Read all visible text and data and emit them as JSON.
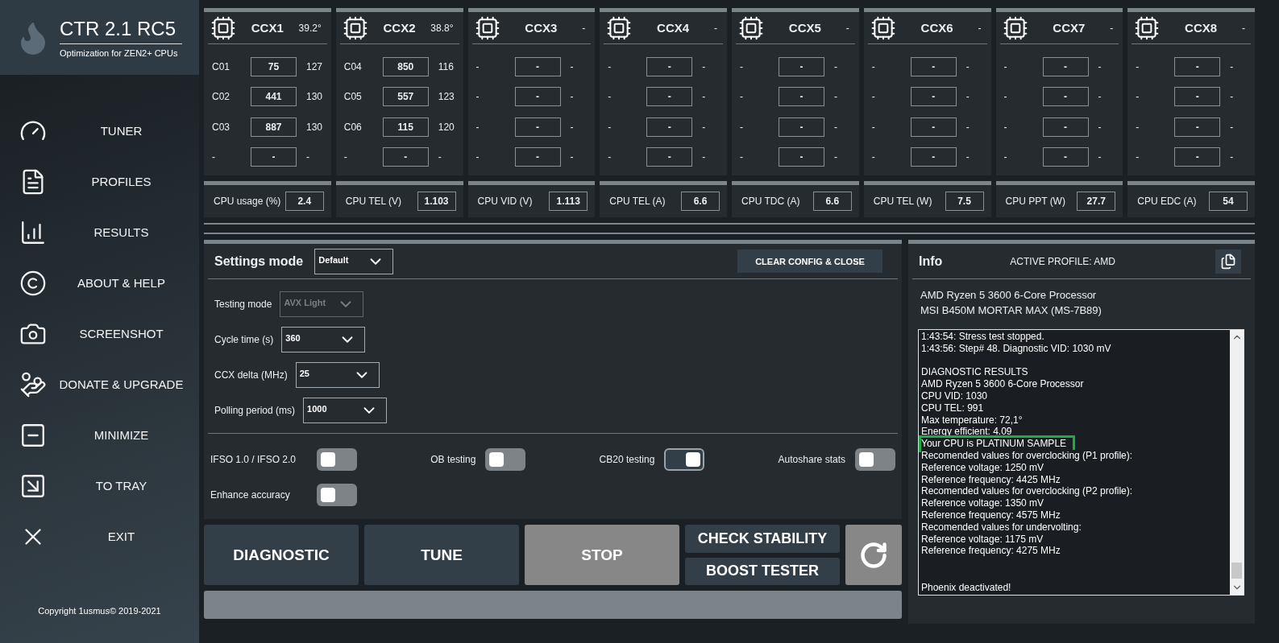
{
  "app": {
    "title": "CTR 2.1 RC5",
    "subtitle": "Optimization for ZEN2+ CPUs"
  },
  "nav": [
    {
      "label": "TUNER",
      "kind": "gauge"
    },
    {
      "label": "PROFILES",
      "kind": "list"
    },
    {
      "label": "RESULTS",
      "kind": "chart"
    },
    {
      "label": "ABOUT & HELP",
      "kind": "copyright"
    },
    {
      "label": "SCREENSHOT",
      "kind": "camera"
    },
    {
      "label": "DONATE & UPGRADE",
      "kind": "donate"
    },
    {
      "label": "MINIMIZE",
      "kind": "minimize"
    },
    {
      "label": "TO TRAY",
      "kind": "tray"
    },
    {
      "label": "EXIT",
      "kind": "exit"
    }
  ],
  "copyright": "Copyright 1usmus© 2019-2021",
  "ccx": [
    {
      "name": "CCX1",
      "temp": "39.2°",
      "cores": [
        {
          "label": "C01",
          "value": "75",
          "reading": "127"
        },
        {
          "label": "C02",
          "value": "441",
          "reading": "130"
        },
        {
          "label": "C03",
          "value": "887",
          "reading": "130"
        },
        {
          "label": "-",
          "value": "-",
          "reading": "-"
        }
      ]
    },
    {
      "name": "CCX2",
      "temp": "38.8°",
      "cores": [
        {
          "label": "C04",
          "value": "850",
          "reading": "116"
        },
        {
          "label": "C05",
          "value": "557",
          "reading": "123"
        },
        {
          "label": "C06",
          "value": "115",
          "reading": "120"
        },
        {
          "label": "-",
          "value": "-",
          "reading": "-"
        }
      ]
    },
    {
      "name": "CCX3",
      "temp": "-",
      "cores": [
        {
          "label": "-",
          "value": "-",
          "reading": "-"
        },
        {
          "label": "-",
          "value": "-",
          "reading": "-"
        },
        {
          "label": "-",
          "value": "-",
          "reading": "-"
        },
        {
          "label": "-",
          "value": "-",
          "reading": "-"
        }
      ]
    },
    {
      "name": "CCX4",
      "temp": "-",
      "cores": [
        {
          "label": "-",
          "value": "-",
          "reading": "-"
        },
        {
          "label": "-",
          "value": "-",
          "reading": "-"
        },
        {
          "label": "-",
          "value": "-",
          "reading": "-"
        },
        {
          "label": "-",
          "value": "-",
          "reading": "-"
        }
      ]
    },
    {
      "name": "CCX5",
      "temp": "-",
      "cores": [
        {
          "label": "-",
          "value": "-",
          "reading": "-"
        },
        {
          "label": "-",
          "value": "-",
          "reading": "-"
        },
        {
          "label": "-",
          "value": "-",
          "reading": "-"
        },
        {
          "label": "-",
          "value": "-",
          "reading": "-"
        }
      ]
    },
    {
      "name": "CCX6",
      "temp": "-",
      "cores": [
        {
          "label": "-",
          "value": "-",
          "reading": "-"
        },
        {
          "label": "-",
          "value": "-",
          "reading": "-"
        },
        {
          "label": "-",
          "value": "-",
          "reading": "-"
        },
        {
          "label": "-",
          "value": "-",
          "reading": "-"
        }
      ]
    },
    {
      "name": "CCX7",
      "temp": "-",
      "cores": [
        {
          "label": "-",
          "value": "-",
          "reading": "-"
        },
        {
          "label": "-",
          "value": "-",
          "reading": "-"
        },
        {
          "label": "-",
          "value": "-",
          "reading": "-"
        },
        {
          "label": "-",
          "value": "-",
          "reading": "-"
        }
      ]
    },
    {
      "name": "CCX8",
      "temp": "-",
      "cores": [
        {
          "label": "-",
          "value": "-",
          "reading": "-"
        },
        {
          "label": "-",
          "value": "-",
          "reading": "-"
        },
        {
          "label": "-",
          "value": "-",
          "reading": "-"
        },
        {
          "label": "-",
          "value": "-",
          "reading": "-"
        }
      ]
    }
  ],
  "stats": [
    {
      "label": "CPU usage (%)",
      "value": "2.4"
    },
    {
      "label": "CPU TEL (V)",
      "value": "1.103"
    },
    {
      "label": "CPU VID (V)",
      "value": "1.113"
    },
    {
      "label": "CPU TEL (A)",
      "value": "6.6"
    },
    {
      "label": "CPU TDC (A)",
      "value": "6.6"
    },
    {
      "label": "CPU TEL (W)",
      "value": "7.5"
    },
    {
      "label": "CPU PPT (W)",
      "value": "27.7"
    },
    {
      "label": "CPU EDC (A)",
      "value": "54"
    }
  ],
  "settings": {
    "title": "Settings mode",
    "mode": "Default",
    "clear_button": "CLEAR CONFIG & CLOSE",
    "options": [
      {
        "label": "Testing mode",
        "value": "AVX Light",
        "disabled": true
      },
      {
        "label": "Cycle time (s)",
        "value": "360",
        "disabled": false
      },
      {
        "label": "CCX delta (MHz)",
        "value": "25",
        "disabled": false
      },
      {
        "label": "Polling period (ms)",
        "value": "1000",
        "disabled": false
      }
    ],
    "toggles": [
      {
        "label": "IFSO 1.0 / IFSO 2.0",
        "on": false
      },
      {
        "label": "OB testing",
        "on": false
      },
      {
        "label": "CB20 testing",
        "on": true
      },
      {
        "label": "Autoshare stats",
        "on": false
      },
      {
        "label": "Enhance accuracy",
        "on": false
      }
    ]
  },
  "actions": {
    "main": [
      {
        "label": "DIAGNOSTIC",
        "disabled": false
      },
      {
        "label": "TUNE",
        "disabled": false
      },
      {
        "label": "STOP",
        "disabled": true
      }
    ],
    "stacked": [
      {
        "label": "CHECK STABILITY",
        "disabled": false
      },
      {
        "label": "BOOST TESTER",
        "disabled": false
      }
    ],
    "refresh": {
      "disabled": true
    }
  },
  "info": {
    "title": "Info",
    "active_profile": "ACTIVE PROFILE: AMD",
    "cpu": "AMD Ryzen 5 3600 6-Core Processor",
    "board": "MSI B450M MORTAR MAX (MS-7B89)",
    "log": [
      {
        "lines": [
          {
            "text": "1:43:54: Stress test stopped.",
            "highlighted": false
          },
          {
            "text": "1:43:56: Step# 48. Diagnostic VID: 1030 mV",
            "highlighted": false
          }
        ]
      },
      {
        "lines": [
          {
            "text": "DIAGNOSTIC RESULTS",
            "highlighted": false
          },
          {
            "text": "AMD Ryzen 5 3600 6-Core Processor",
            "highlighted": false
          },
          {
            "text": "CPU VID: 1030",
            "highlighted": false
          },
          {
            "text": "CPU TEL: 991",
            "highlighted": false
          },
          {
            "text": "Max temperature: 72,1°",
            "highlighted": false
          },
          {
            "text": "Energy efficient: 4.09",
            "highlighted": false
          },
          {
            "text": "Your CPU is PLATINUM SAMPLE",
            "highlighted": true
          },
          {
            "text": "Recomended values for overclocking (P1 profile):",
            "highlighted": false
          },
          {
            "text": "Reference voltage: 1250 mV",
            "highlighted": false
          },
          {
            "text": "Reference frequency: 4425 MHz",
            "highlighted": false
          },
          {
            "text": "Recomended values for overclocking (P2 profile):",
            "highlighted": false
          },
          {
            "text": "Reference voltage: 1350 mV",
            "highlighted": false
          },
          {
            "text": "Reference frequency: 4575 MHz",
            "highlighted": false
          },
          {
            "text": "Recomended values for undervolting:",
            "highlighted": false
          },
          {
            "text": "Reference voltage: 1175 mV",
            "highlighted": false
          },
          {
            "text": "Reference frequency: 4275 MHz",
            "highlighted": false
          }
        ]
      },
      {
        "lines": [
          {
            "text": "Phoenix deactivated!",
            "highlighted": false
          }
        ]
      }
    ]
  }
}
